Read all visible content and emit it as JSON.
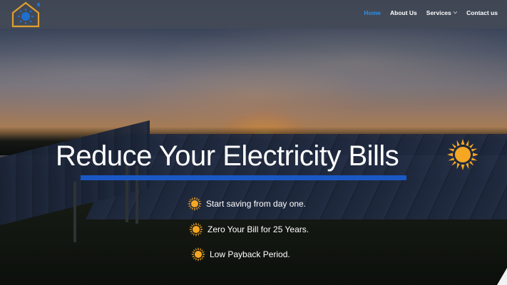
{
  "brand": {
    "logo_icon": "house-sun-logo-icon",
    "logo_color": "#e0a030",
    "logo_accent": "#1f6fd0"
  },
  "nav": {
    "items": [
      {
        "label": "Home",
        "active": true
      },
      {
        "label": "About Us",
        "active": false
      },
      {
        "label": "Services",
        "active": false,
        "has_dropdown": true
      },
      {
        "label": "Contact us",
        "active": false
      }
    ],
    "active_color": "#2e8fe6",
    "chevron_icon": "chevron-down-icon"
  },
  "hero": {
    "headline": "Reduce Your Electricity Bills",
    "headline_icon": "sun-icon",
    "underline_color": "#1a58c6",
    "bullets": [
      {
        "text": "Start saving from day one.",
        "icon": "sun-icon"
      },
      {
        "text": "Zero Your Bill for 25 Years.",
        "icon": "sun-icon"
      },
      {
        "text": "Low Payback Period.",
        "icon": "sun-icon"
      }
    ],
    "sun_color": "#f5a623"
  }
}
